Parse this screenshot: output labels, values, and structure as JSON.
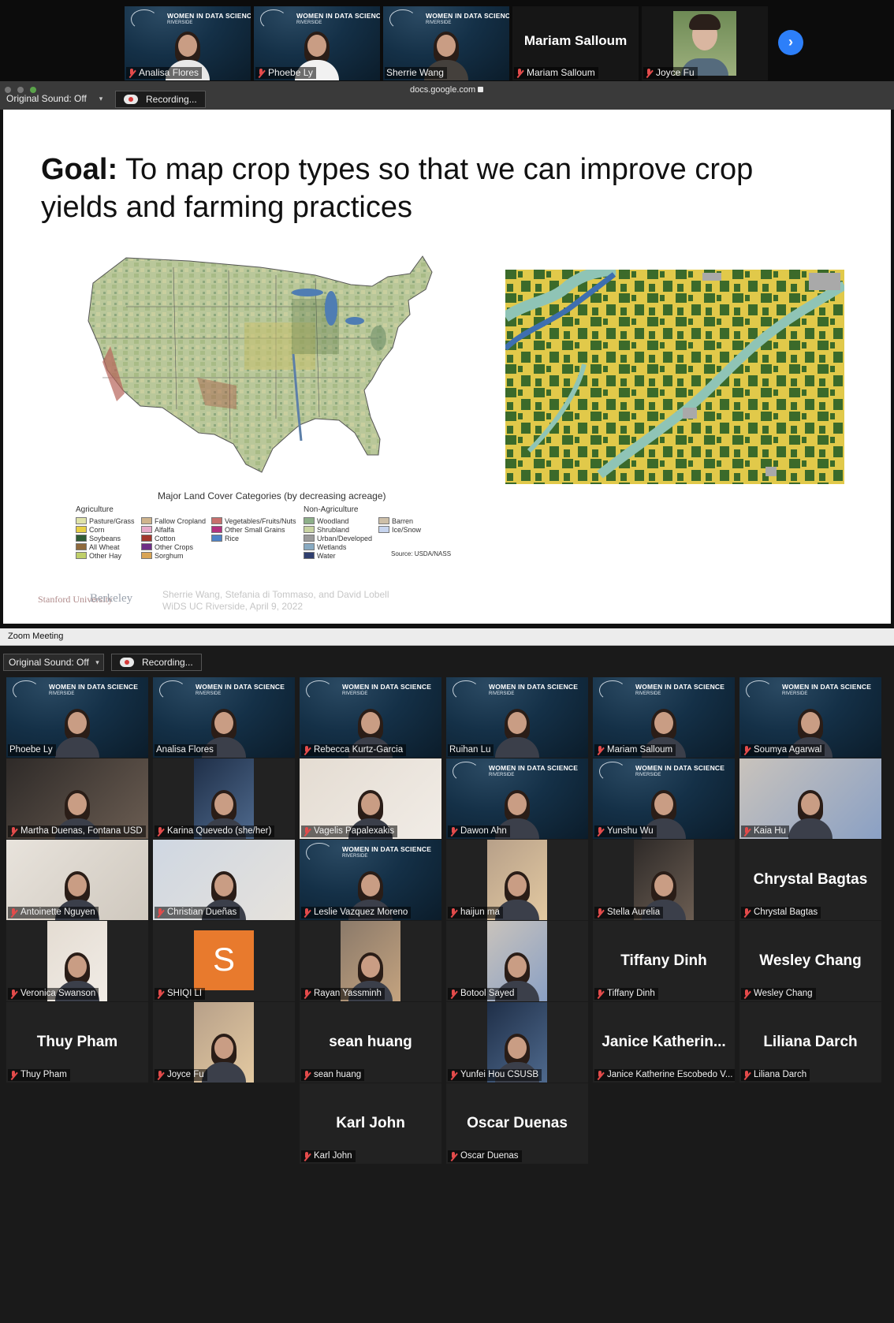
{
  "top_strip": {
    "tiles": [
      {
        "name": "Analisa Flores",
        "banner_title": "WOMEN IN DATA SCIENCE",
        "banner_sub": "RIVERSIDE"
      },
      {
        "name": "Phoebe Ly",
        "banner_title": "WOMEN IN DATA SCIENCE",
        "banner_sub": "RIVERSIDE"
      },
      {
        "name": "Sherrie Wang",
        "banner_title": "WOMEN IN DATA SCIENCE",
        "banner_sub": "RIVERSIDE"
      },
      {
        "name": "Mariam Salloum",
        "big_label": "Mariam Salloum"
      },
      {
        "name": "Joyce Fu"
      }
    ],
    "next_icon": "chevron-right-icon"
  },
  "top_toolbar": {
    "original_sound": "Original Sound: Off",
    "recording": "Recording...",
    "url": "docs.google.com"
  },
  "slide": {
    "goal_bold": "Goal:",
    "goal_text": " To map crop types so that we can improve crop yields and farming practices",
    "legend_title": "Major Land Cover Categories (by decreasing acreage)",
    "agriculture_head": "Agriculture",
    "nonagriculture_head": "Non-Agriculture",
    "legend_agri_col1": [
      {
        "label": "Pasture/Grass",
        "color": "#dfe3a9"
      },
      {
        "label": "Corn",
        "color": "#e7cf45"
      },
      {
        "label": "Soybeans",
        "color": "#2f5b35"
      },
      {
        "label": "All Wheat",
        "color": "#8f6a3d"
      },
      {
        "label": "Other Hay",
        "color": "#bfcf6a"
      }
    ],
    "legend_agri_col2": [
      {
        "label": "Fallow Cropland",
        "color": "#cfb48d"
      },
      {
        "label": "Alfalfa",
        "color": "#e6a9c9"
      },
      {
        "label": "Cotton",
        "color": "#a2372e"
      },
      {
        "label": "Other Crops",
        "color": "#6e2f86"
      },
      {
        "label": "Sorghum",
        "color": "#d8a455"
      }
    ],
    "legend_agri_col3": [
      {
        "label": "Vegetables/Fruits/Nuts",
        "color": "#c7706d"
      },
      {
        "label": "Other Small Grains",
        "color": "#b2327f"
      },
      {
        "label": "Rice",
        "color": "#4e82c7"
      }
    ],
    "legend_non_col1": [
      {
        "label": "Woodland",
        "color": "#8eb08a"
      },
      {
        "label": "Shrubland",
        "color": "#c9d4a2"
      },
      {
        "label": "Urban/Developed",
        "color": "#9a9a9a"
      },
      {
        "label": "Wetlands",
        "color": "#88aac2"
      },
      {
        "label": "Water",
        "color": "#2f3e6e"
      }
    ],
    "legend_non_col2": [
      {
        "label": "Barren",
        "color": "#cdbfa8"
      },
      {
        "label": "Ice/Snow",
        "color": "#c6d4ee"
      }
    ],
    "source": "Source:  USDA/NASS",
    "stanford_logo": "Stanford University",
    "berkeley_logo": "Berkeley",
    "footer_authors": "Sherrie Wang, Stefania di Tommaso, and David Lobell",
    "footer_event": "WiDS UC Riverside, April 9, 2022"
  },
  "zoom_window": {
    "title": "Zoom Meeting",
    "original_sound": "Original Sound: Off",
    "recording": "Recording..."
  },
  "gallery": [
    {
      "name": "Phoebe Ly",
      "type": "wids",
      "muted": false
    },
    {
      "name": "Analisa Flores",
      "type": "wids",
      "muted": false,
      "active": true
    },
    {
      "name": "Rebecca Kurtz-Garcia",
      "type": "wids",
      "muted": true
    },
    {
      "name": "Ruihan Lu",
      "type": "wids",
      "muted": false
    },
    {
      "name": "Mariam Salloum",
      "type": "wids",
      "muted": true
    },
    {
      "name": "Soumya Agarwal",
      "type": "wids",
      "muted": true
    },
    {
      "name": "Martha Duenas, Fontana USD",
      "type": "photo",
      "muted": true
    },
    {
      "name": "Karina Quevedo (she/her)",
      "type": "photo-small",
      "muted": true
    },
    {
      "name": "Vagelis Papalexakis",
      "type": "photo",
      "muted": true
    },
    {
      "name": "Dawon Ahn",
      "type": "wids",
      "muted": true
    },
    {
      "name": "Yunshu Wu",
      "type": "wids",
      "muted": true
    },
    {
      "name": "Kaia Hu",
      "type": "photo",
      "muted": true
    },
    {
      "name": "Antoinette Nguyen",
      "type": "photo",
      "muted": true
    },
    {
      "name": "Christian Dueñas",
      "type": "photo",
      "muted": true
    },
    {
      "name": "Leslie Vazquez Moreno",
      "type": "wids",
      "muted": true
    },
    {
      "name": "haijun ma",
      "type": "photo-small",
      "muted": true
    },
    {
      "name": "Stella Aurelia",
      "type": "photo-small",
      "muted": true
    },
    {
      "name": "Chrystal Bagtas",
      "type": "text",
      "big_label": "Chrystal Bagtas",
      "muted": true
    },
    {
      "name": "Veronica Swanson",
      "type": "photo-small",
      "muted": true
    },
    {
      "name": "SHIQI LI",
      "type": "avatar",
      "avatar_letter": "S",
      "muted": true
    },
    {
      "name": "Rayan Yassminh",
      "type": "photo-small",
      "muted": true
    },
    {
      "name": "Botool Sayed",
      "type": "photo-small",
      "muted": true
    },
    {
      "name": "Tiffany Dinh",
      "type": "text",
      "big_label": "Tiffany Dinh",
      "muted": true
    },
    {
      "name": "Wesley Chang",
      "type": "text",
      "big_label": "Wesley Chang",
      "muted": true
    },
    {
      "name": "Thuy Pham",
      "type": "text",
      "big_label": "Thuy Pham",
      "muted": true
    },
    {
      "name": "Joyce Fu",
      "type": "photo-small",
      "muted": true
    },
    {
      "name": "sean huang",
      "type": "text",
      "big_label": "sean huang",
      "muted": true
    },
    {
      "name": "Yunfei Hou CSUSB",
      "type": "photo-small",
      "muted": true
    },
    {
      "name": "Janice Katherine Escobedo V...",
      "type": "text",
      "big_label": "Janice  Katherin...",
      "muted": true
    },
    {
      "name": "Liliana Darch",
      "type": "text",
      "big_label": "Liliana Darch",
      "muted": true
    },
    {
      "name": "Karl John",
      "type": "text",
      "big_label": "Karl John",
      "muted": true
    },
    {
      "name": "Oscar Duenas",
      "type": "text",
      "big_label": "Oscar Duenas",
      "muted": true
    }
  ],
  "wids_banner": {
    "title": "WOMEN IN DATA SCIENCE",
    "sub": "RIVERSIDE"
  },
  "colors": {
    "active_speaker_border": "#c9dd7e",
    "strip_active_border": "#9ccc4a",
    "mute_red": "#e34b4b",
    "next_button_blue": "#2d7ff9",
    "field_corn": "#e1c94a",
    "field_soy": "#3b6a2a",
    "field_water": "#3e6fb0",
    "field_wetland": "#8fc4b6"
  }
}
